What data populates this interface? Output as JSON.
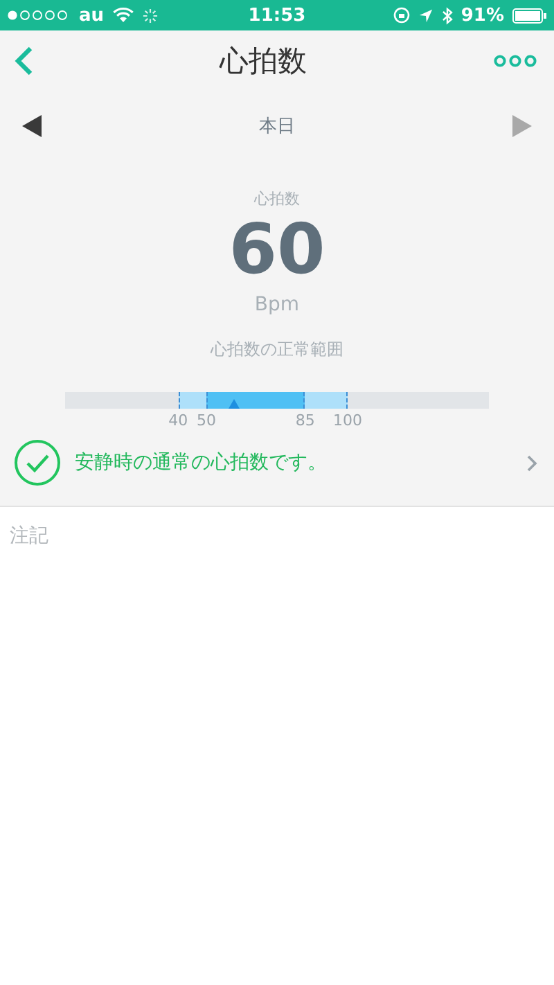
{
  "status_bar": {
    "carrier": "au",
    "time": "11:53",
    "battery": "91%"
  },
  "nav": {
    "title": "心拍数"
  },
  "date_nav": {
    "label": "本日"
  },
  "reading": {
    "label": "心拍数",
    "value": "60",
    "unit": "Bpm"
  },
  "range": {
    "title": "心拍数の正常範囲",
    "outer": [
      "40",
      "100"
    ],
    "inner": [
      "50",
      "85"
    ]
  },
  "status": {
    "message": "安静時の通常の心拍数です。"
  },
  "notes": {
    "placeholder": "注記"
  }
}
